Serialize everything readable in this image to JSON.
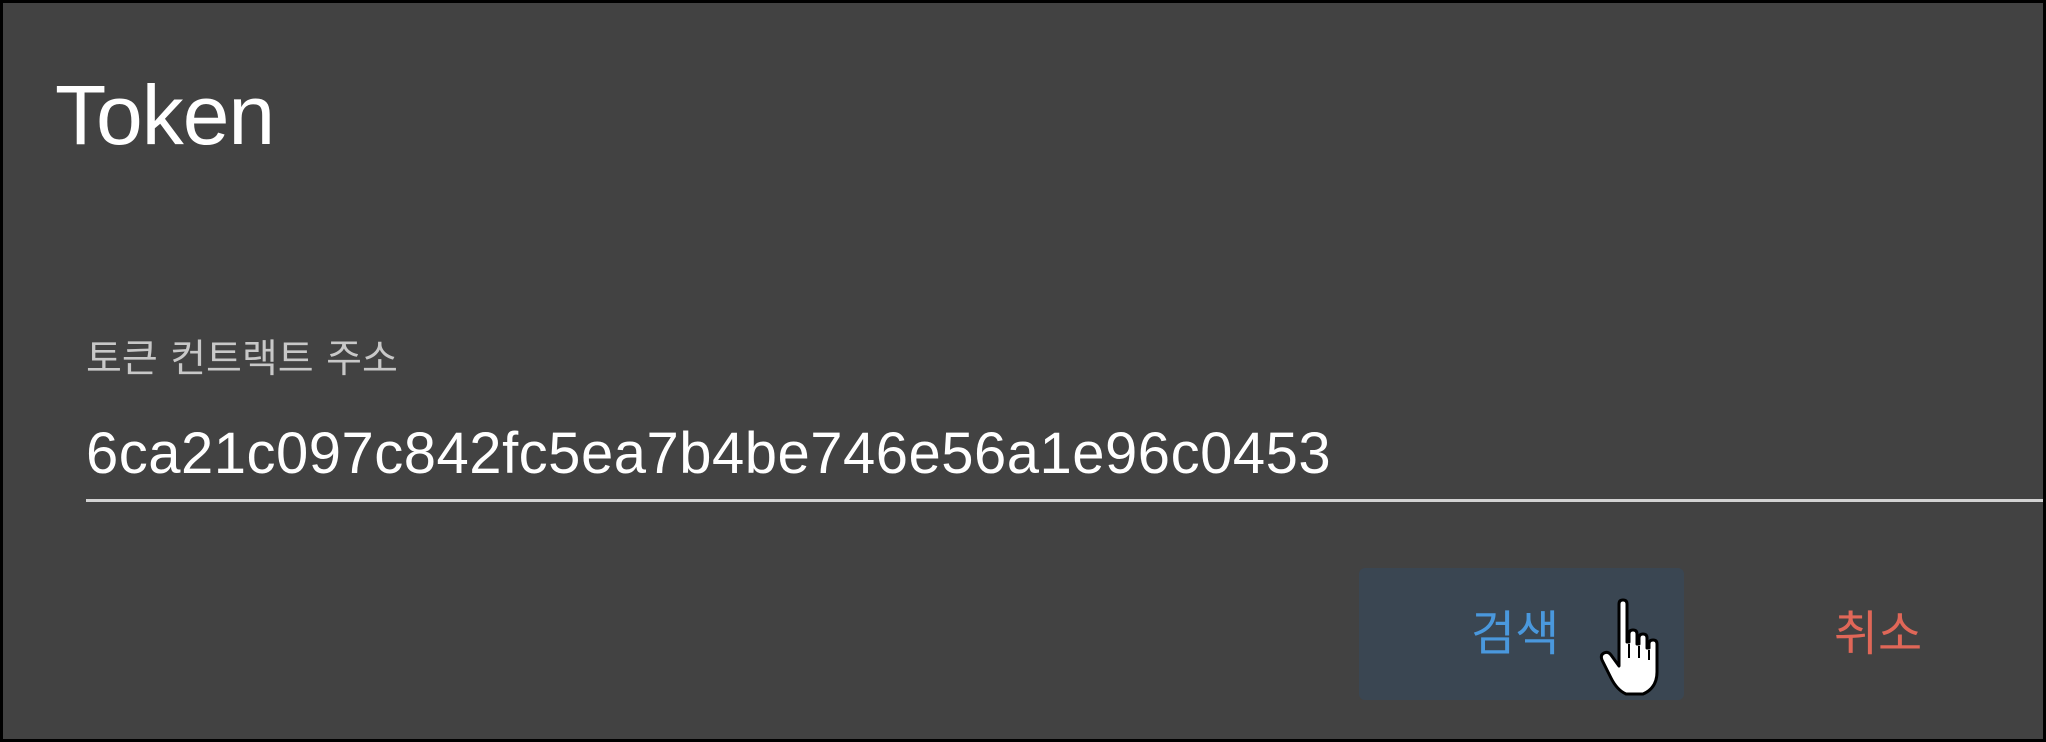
{
  "dialog": {
    "title": "Token"
  },
  "field": {
    "label": "토큰 컨트랙트 주소",
    "value": "6ca21c097c842fc5ea7b4be746e56a1e96c0453"
  },
  "actions": {
    "search_label": "검색",
    "cancel_label": "취소"
  },
  "colors": {
    "background": "#424242",
    "primary": "#4a98dd",
    "danger": "#e06758",
    "search_button_bg": "#3a4652"
  },
  "icons": {
    "cursor": "hand-pointer-icon"
  }
}
